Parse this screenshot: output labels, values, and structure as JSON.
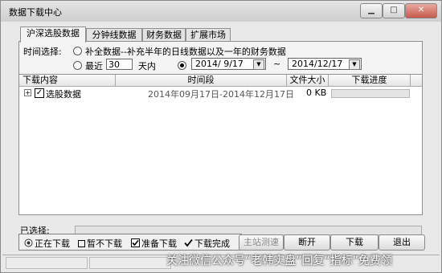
{
  "window": {
    "title": "数据下载中心",
    "buttons": {
      "minimize": "▁",
      "maximize": "□",
      "close": "✕"
    }
  },
  "tabs": [
    {
      "label": "沪深选股数据",
      "active": true
    },
    {
      "label": "分钟线数据",
      "active": false
    },
    {
      "label": "财务数据",
      "active": false
    },
    {
      "label": "扩展市场",
      "active": false
    }
  ],
  "time_select": {
    "label": "时间选择:",
    "option_full": "补全数据--补充半年的日线数据以及一年的财务数据",
    "recent_label": "最近",
    "recent_value": "30",
    "recent_unit": "天内",
    "start_date": "2014/ 9/17",
    "separator": "~",
    "end_date": "2014/12/17",
    "selected": "date_range"
  },
  "table": {
    "headers": [
      "下载内容",
      "时间段",
      "文件大小",
      "下载进度"
    ],
    "rows": [
      {
        "expander": "+",
        "checked": true,
        "name": "选股数据",
        "period": "2014年09月17日-2014年12月17日",
        "size": "0 KB",
        "progress": 0
      }
    ]
  },
  "selected_bar": {
    "label": "已选择:"
  },
  "legend": [
    {
      "icon": "downloading-icon",
      "label": "正在下载"
    },
    {
      "icon": "unchecked-box-icon",
      "label": "暂不下载"
    },
    {
      "icon": "checked-box-icon",
      "label": "准备下载"
    },
    {
      "icon": "checkmark-icon",
      "label": "下载完成"
    }
  ],
  "buttons": {
    "main_station": "主站测速",
    "disconnect": "断开",
    "download": "下载",
    "exit": "退出"
  },
  "watermark": "关注微信公众号“老韩实盘”回复“指标”免费领",
  "colors": {
    "window_bg": "#e9e9e9",
    "title_bar": "#d9d9d9",
    "close_button": "#c6594c"
  }
}
